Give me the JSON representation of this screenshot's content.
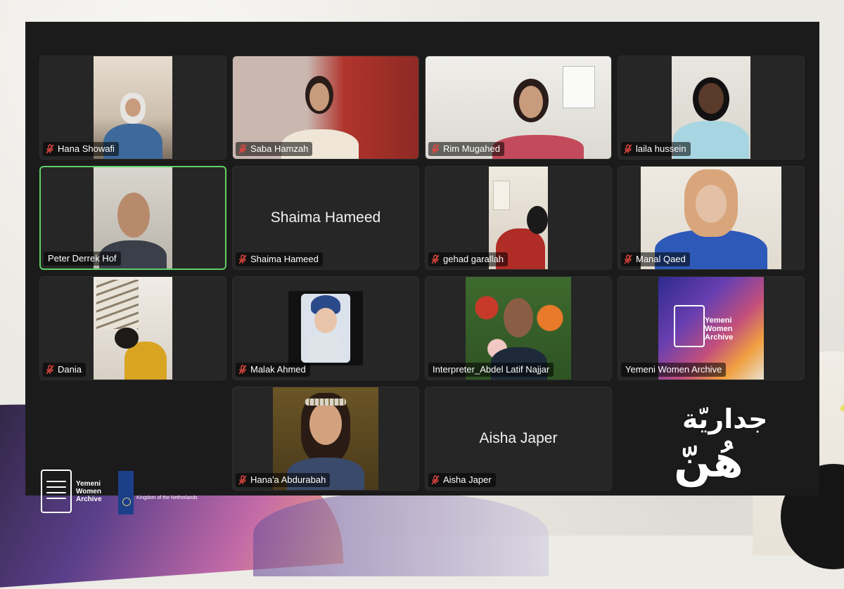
{
  "participants": [
    {
      "name": "Hana Showafi",
      "muted": true
    },
    {
      "name": "Saba Hamzah",
      "muted": true
    },
    {
      "name": "Rim Mugahed",
      "muted": true
    },
    {
      "name": "laila hussein",
      "muted": true
    },
    {
      "name": "Peter Derrek Hof",
      "muted": false,
      "active_speaker": true
    },
    {
      "name": "Shaima Hameed",
      "muted": true,
      "video_off": true,
      "display_name": "Shaima Hameed"
    },
    {
      "name": "gehad garallah",
      "muted": true
    },
    {
      "name": "Manal Qaed",
      "muted": true
    },
    {
      "name": "Dania",
      "muted": true
    },
    {
      "name": "Malak Ahmed",
      "muted": true
    },
    {
      "name": "Interpreter_Abdel Latif Najjar",
      "muted": false
    },
    {
      "name": "Yemeni Women Archive",
      "muted": false
    },
    {
      "name": "Hana'a Abdurabah",
      "muted": true
    },
    {
      "name": "Aisha Japer",
      "muted": true,
      "video_off": true,
      "display_name": "Aisha Japer"
    }
  ],
  "tile_logo": {
    "line1": "Yemeni",
    "line2": "Women",
    "line3": "Archive"
  },
  "branding": {
    "org_line1": "Yemeni",
    "org_line2": "Women",
    "org_line3": "Archive",
    "sponsor": "Kingdom of the Netherlands",
    "arabic_line1": "جداريّة",
    "arabic_line2": "هُنّ"
  },
  "colors": {
    "active_speaker_border": "#5fd068",
    "mute_icon": "#e5483f",
    "tile_bg": "#262626"
  }
}
